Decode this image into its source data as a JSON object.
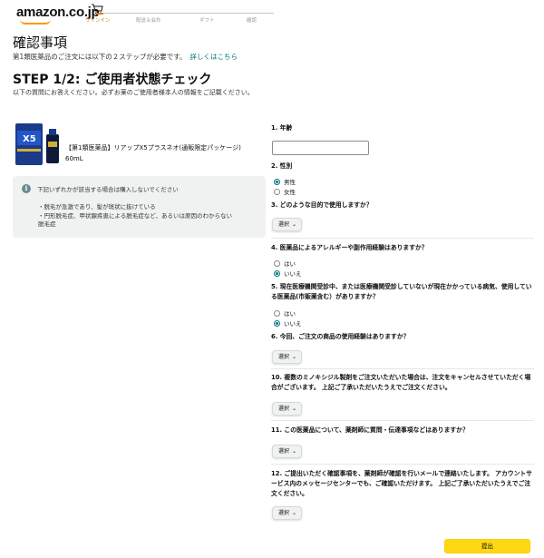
{
  "header": {
    "logo_text": "amazon.co.jp",
    "steps": [
      "サインイン",
      "配送＆会計",
      "ギフト",
      "確認"
    ]
  },
  "page": {
    "title": "確認事項",
    "subtitle": "第1類医薬品のご注文には以下の２ステップが必要です。",
    "subtitle_link": "詳しくはこちら",
    "step_title": "STEP 1/2: ご使用者状態チェック",
    "step_desc": "以下の質問にお答えください。必ずお薬のご使用者様本人の情報をご記載ください。"
  },
  "product": {
    "name_line1": "【第1類医薬品】リアップX5プラスネオ(通販限定パッケージ)",
    "name_line2": "60mL",
    "image_label": "X5"
  },
  "info": {
    "title": "下記いずれかが該当する場合は購入しないでください",
    "items": [
      "・脱毛が急激であり、髪が斑状に抜けている",
      "・円形脱毛症、甲状腺疾患による脱毛症など、あるいは原因のわからない",
      "脱毛症"
    ]
  },
  "questions": {
    "q1": "1. 年齢",
    "q2": "2. 性別",
    "q2_options": [
      "男性",
      "女性"
    ],
    "q3": "3. どのような目的で使用しますか？",
    "q4": "4. 医薬品によるアレルギーや副作用経験はありますか？",
    "q4_options": [
      "はい",
      "いいえ"
    ],
    "q5": "5. 現在医療機関受診中、または医療機関受診していないが現在かかっている病気、使用している医薬品(市販薬含む）がありますか？",
    "q5_options": [
      "はい",
      "いいえ"
    ],
    "q6": "6. 今回、ご注文の商品の使用経験はありますか？",
    "q10": "10. 複数のミノキシジル製剤をご注文いただいた場合は、注文をキャンセルさせていただく場合がございます。 上記ご了承いただいたうえでご注文ください。",
    "q11": "11. この医薬品について、薬剤師に質問・伝達事項などはありますか？",
    "q12": "12. ご提出いただく確認事項を、薬剤師が確認を行いメールで連絡いたします。 アカウントサービス内のメッセージセンターでも、ご確認いただけます。 上記ご了承いただいたうえでご注文ください。"
  },
  "select": {
    "label": "選択"
  },
  "submit": {
    "label": "提出"
  },
  "colors": {
    "accent": "#007185",
    "button": "#ffd814",
    "progress": "#e47911"
  }
}
